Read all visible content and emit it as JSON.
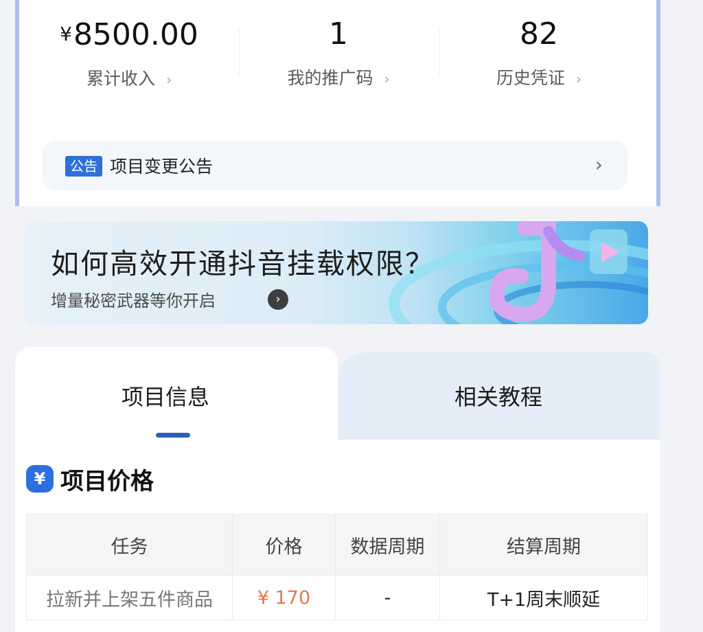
{
  "stats": [
    {
      "currency": "¥",
      "value": "8500.00",
      "label": "累计收入",
      "chevron": "›"
    },
    {
      "currency": "",
      "value": "1",
      "label": "我的推广码",
      "chevron": "›"
    },
    {
      "currency": "",
      "value": "82",
      "label": "历史凭证",
      "chevron": "›"
    }
  ],
  "notice": {
    "badge": "公告",
    "text": "项目变更公告",
    "chevron": "›"
  },
  "banner": {
    "title": "如何高效开通抖音挂载权限？",
    "subtitle": "增量秘密武器等你开启",
    "arrow": "›"
  },
  "tabs": [
    {
      "label": "项目信息",
      "active": true
    },
    {
      "label": "相关教程",
      "active": false
    }
  ],
  "section": {
    "icon": "¥",
    "title": "项目价格"
  },
  "table": {
    "headers": [
      "任务",
      "价格",
      "数据周期",
      "结算周期"
    ],
    "rows": [
      [
        "拉新并上架五件商品",
        "¥ 170",
        "-",
        "T+1周末顺延"
      ]
    ]
  },
  "colors": {
    "accent": "#2c6fe0",
    "price": "#e07a4a",
    "tab_inactive": "#e4eef9",
    "card_border": "#aebfee"
  }
}
